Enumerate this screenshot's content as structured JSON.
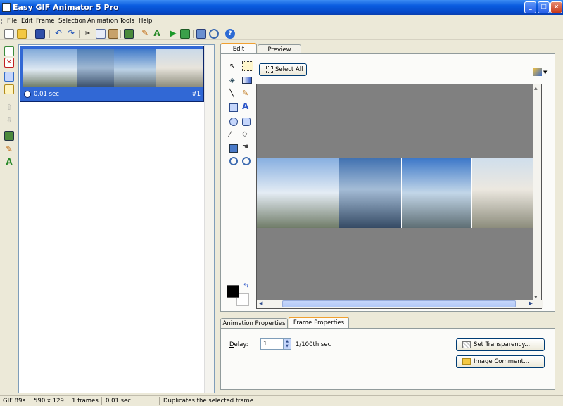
{
  "window": {
    "title": "Easy GIF Animator 5 Pro"
  },
  "menu": [
    "File",
    "Edit",
    "Frame",
    "Selection",
    "Animation",
    "Tools",
    "Help"
  ],
  "toolbar_icons": [
    "new-icon",
    "open-icon",
    "save-icon",
    "undo-icon",
    "redo-icon",
    "cut-icon",
    "copy-icon",
    "paste-icon",
    "resize-icon",
    "wand-icon",
    "text-icon",
    "play-icon",
    "preview-icon",
    "optimize-icon",
    "zoom-icon",
    "help-icon"
  ],
  "frames": [
    {
      "duration": "0.01 sec",
      "number": "#1"
    }
  ],
  "tabs": {
    "edit": "Edit",
    "preview": "Preview"
  },
  "edit": {
    "select_all_pre": "Select ",
    "select_all_u": "A",
    "select_all_post": "ll"
  },
  "prop_tabs": {
    "animation": "Animation Properties",
    "frame": "Frame Properties"
  },
  "frame_props": {
    "delay_label_pre": "D",
    "delay_label_post": "elay:",
    "delay_value": "1",
    "delay_unit": "1/100th sec",
    "set_transparency": "Set Transparency...",
    "image_comment": "Image Comment..."
  },
  "status": {
    "format": "GIF 89a",
    "size": "590 x 129",
    "frames": "1 frames",
    "duration": "0.01 sec",
    "hint": "Duplicates the selected frame"
  },
  "colors": {
    "accent": "#0a5de0",
    "selection": "#3168d5",
    "canvas_bg": "#808080",
    "foreground": "#000000",
    "background": "#ffffff"
  }
}
